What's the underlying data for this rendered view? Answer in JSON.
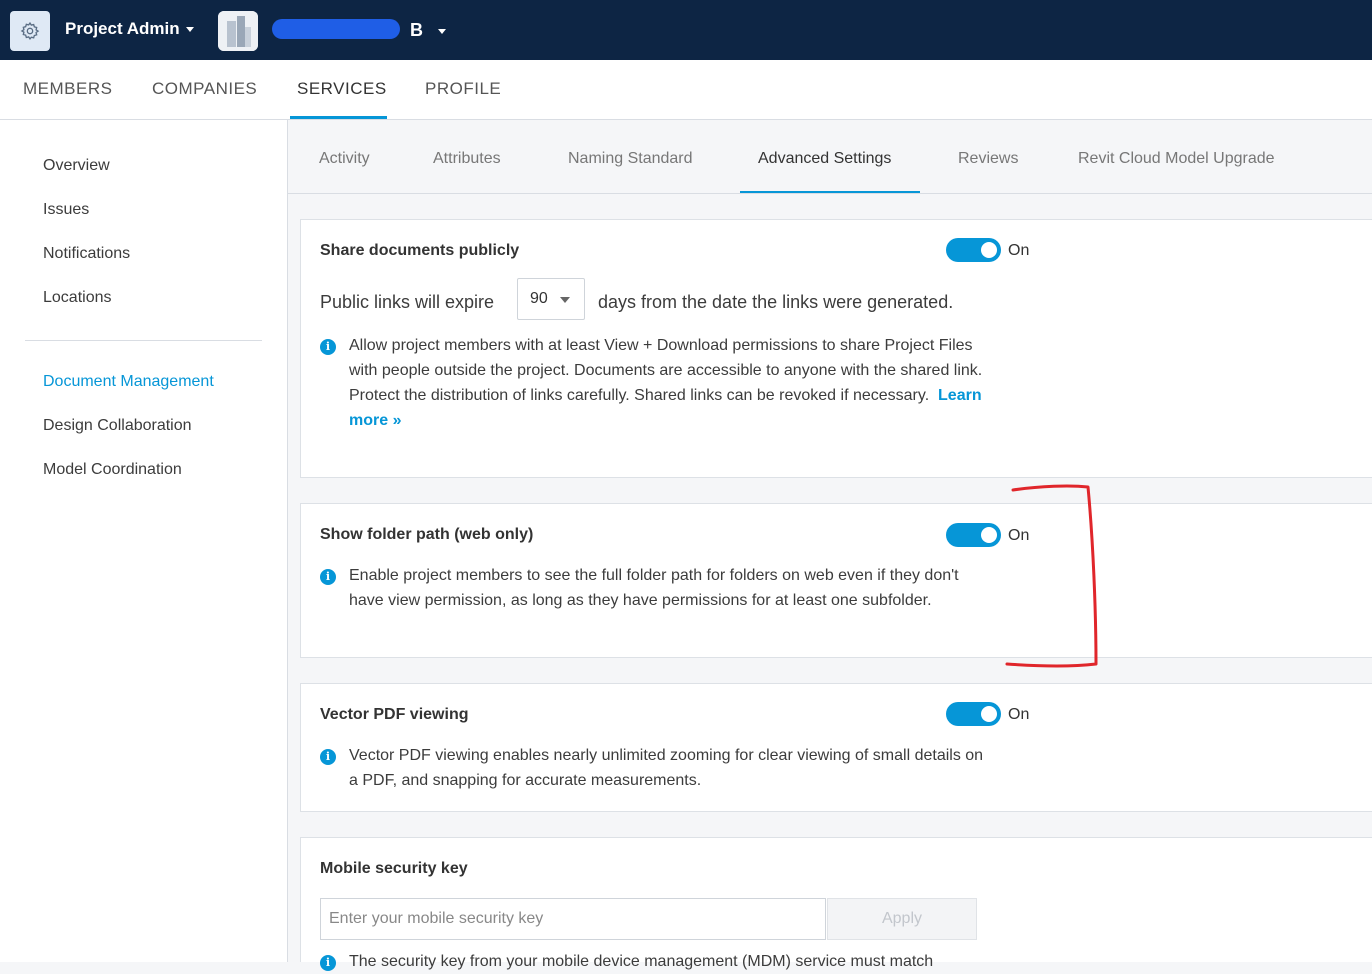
{
  "header": {
    "app_title": "Project Admin",
    "project_letter": "B",
    "colors": {
      "bar": "#0d2544",
      "accent": "#0696d7"
    }
  },
  "nav": {
    "tabs": [
      {
        "label": "MEMBERS"
      },
      {
        "label": "COMPANIES"
      },
      {
        "label": "SERVICES"
      },
      {
        "label": "PROFILE"
      }
    ],
    "active": "SERVICES"
  },
  "sidebar": {
    "items": [
      {
        "label": "Overview"
      },
      {
        "label": "Issues"
      },
      {
        "label": "Notifications"
      },
      {
        "label": "Locations"
      },
      {
        "label": "Document Management"
      },
      {
        "label": "Design Collaboration"
      },
      {
        "label": "Model Coordination"
      }
    ],
    "active": "Document Management"
  },
  "subtabs": {
    "items": [
      {
        "label": "Activity"
      },
      {
        "label": "Attributes"
      },
      {
        "label": "Naming Standard"
      },
      {
        "label": "Advanced Settings"
      },
      {
        "label": "Reviews"
      },
      {
        "label": "Revit Cloud Model Upgrade"
      }
    ],
    "active": "Advanced Settings"
  },
  "settings": {
    "share": {
      "title": "Share documents publicly",
      "toggle_label": "On",
      "expire_before": "Public links will expire",
      "expire_value": "90",
      "expire_after": "days from the date the links were generated.",
      "info_1": "Allow project members with at least View + Download permissions to share Project Files with people outside the project. Documents are accessible to anyone with the shared link.",
      "info_2": "Protect the distribution of links carefully. Shared links can be revoked if necessary.",
      "learn_more": "Learn more »"
    },
    "folder_path": {
      "title": "Show folder path (web only)",
      "toggle_label": "On",
      "info": "Enable project members to see the full folder path for folders on web even if they don't have view permission, as long as they have permissions for at least one subfolder."
    },
    "vector_pdf": {
      "title": "Vector PDF viewing",
      "toggle_label": "On",
      "info": "Vector PDF viewing enables nearly unlimited zooming for clear viewing of small details on a PDF, and snapping for accurate measurements."
    },
    "mobile_key": {
      "title": "Mobile security key",
      "placeholder": "Enter your mobile security key",
      "apply_label": "Apply",
      "info": "The security key from your mobile device management (MDM) service must match"
    }
  }
}
